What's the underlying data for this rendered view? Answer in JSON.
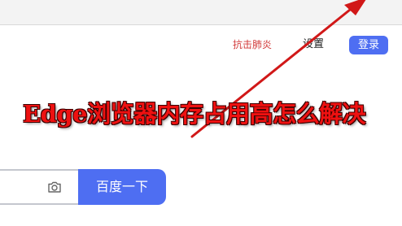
{
  "header": {
    "hot_topic_link": "抗击肺炎",
    "settings_link": "设置",
    "login_button": "登录"
  },
  "search": {
    "value": "",
    "submit_label": "百度一下"
  },
  "overlay": {
    "title": "Edge浏览器内存占用高怎么解决"
  },
  "icons": {
    "camera": "camera-icon"
  },
  "colors": {
    "accent": "#4e6ef2",
    "hot_link": "#d23a3a",
    "overlay_text": "#ee1111",
    "arrow": "#d11818"
  }
}
